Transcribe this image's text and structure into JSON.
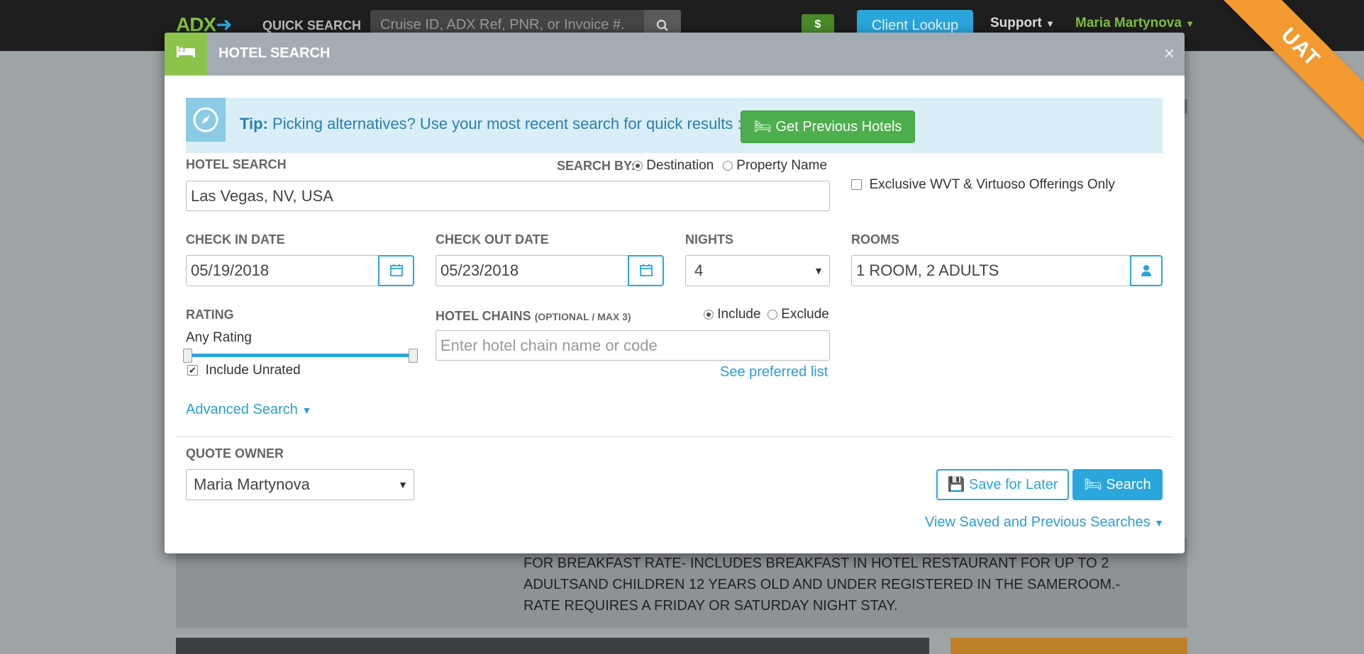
{
  "topnav": {
    "logo": "ADX",
    "quick_search_label": "QUICK SEARCH",
    "search_placeholder": "Cruise ID, ADX Ref, PNR, or Invoice #.",
    "dollar": "$",
    "client_lookup": "Client Lookup",
    "support": "Support",
    "user": "Maria Martynova"
  },
  "ribbon": "UAT",
  "background": {
    "text": "FOR BREAKFAST RATE- INCLUDES BREAKFAST IN HOTEL RESTAURANT FOR UP TO 2 ADULTSAND CHILDREN 12 YEARS OLD AND UNDER REGISTERED IN THE SAMEROOM.- RATE REQUIRES A FRIDAY OR SATURDAY NIGHT STAY."
  },
  "modal": {
    "title": "HOTEL SEARCH",
    "close": "×",
    "tip": {
      "label": "Tip:",
      "text": "Picking alternatives? Use your most recent search for quick results :",
      "button": "Get Previous Hotels"
    },
    "hotel_search": {
      "label": "HOTEL SEARCH",
      "search_by_label": "SEARCH BY:",
      "option_destination": "Destination",
      "option_property": "Property Name",
      "value": "Las Vegas, NV, USA"
    },
    "exclusive_label": "Exclusive WVT & Virtuoso Offerings Only",
    "check_in": {
      "label": "CHECK IN DATE",
      "value": "05/19/2018"
    },
    "check_out": {
      "label": "CHECK OUT DATE",
      "value": "05/23/2018"
    },
    "nights": {
      "label": "NIGHTS",
      "value": "4"
    },
    "rooms": {
      "label": "ROOMS",
      "value": "1 ROOM, 2 ADULTS"
    },
    "rating": {
      "label": "RATING",
      "value": "Any Rating",
      "include_unrated": "Include Unrated"
    },
    "chains": {
      "label": "HOTEL CHAINS",
      "label_note": "(OPTIONAL / MAX 3)",
      "include": "Include",
      "exclude": "Exclude",
      "placeholder": "Enter hotel chain name or code",
      "preferred_link": "See preferred list"
    },
    "advanced_search": "Advanced Search",
    "quote_owner": {
      "label": "QUOTE OWNER",
      "value": "Maria Martynova"
    },
    "save_later": "Save for Later",
    "search_button": "Search",
    "view_saved": "View Saved and Previous Searches"
  }
}
